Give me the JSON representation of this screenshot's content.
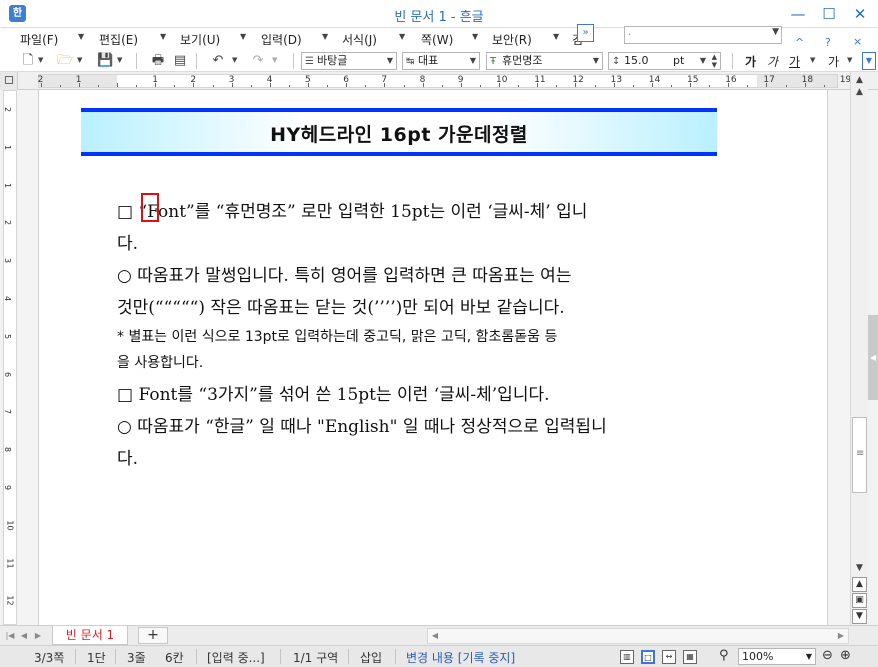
{
  "window": {
    "title": "빈 문서 1 - 흔글",
    "app_icon": "한",
    "controls": [
      "minimize-icon",
      "maximize-icon",
      "close-icon"
    ]
  },
  "menu": {
    "items": [
      "파일(F)",
      "편집(E)",
      "보기(U)",
      "입력(D)",
      "서식(J)",
      "쪽(W)",
      "보안(R)",
      "검"
    ],
    "more": "»",
    "search_value": ".",
    "right_controls": [
      "^",
      "?",
      "×"
    ]
  },
  "toolbar": {
    "style_combo": "바탕글",
    "font_type_combo": "대표",
    "font_combo": "휴먼명조",
    "size_value": "15.0",
    "size_unit": "pt",
    "format_buttons": [
      "가",
      "가",
      "가",
      "가"
    ]
  },
  "ruler": {
    "h_numbers": [
      "2",
      "1",
      "1",
      "2",
      "3",
      "4",
      "5",
      "6",
      "7",
      "8",
      "9",
      "10",
      "11",
      "12",
      "13",
      "14",
      "15",
      "16",
      "17",
      "18",
      "19"
    ],
    "v_numbers": [
      "2",
      "1",
      "1",
      "2",
      "3",
      "4",
      "5",
      "6",
      "7",
      "8",
      "9",
      "10",
      "11",
      "12",
      "13"
    ]
  },
  "document": {
    "heading": "HY헤드라인 16pt 가운데정렬",
    "paragraphs": [
      "□ “Font”를  “휴먼명조” 로만  입력한  15pt는  이런  ‘글씨-체’ 입니",
      "다.",
      "  ○  따옴표가  말썽입니다.  특히  영어를  입력하면  큰  따옴표는  여는",
      "것만(“““““)  작은  따옴표는  닫는  것(’’’’)만  되어  바보  같습니다.",
      "  * 별표는  이런  식으로  13pt로  입력하는데  중고딕,  맑은  고딕,  함초롬돋움  등",
      "을  사용합니다.",
      "□ Font를 “3가지”를  섞어  쓴  15pt는  이런 ‘글씨-체’입니다.",
      "  ○  따옴표가 “한글”  일  때나  \"English\"  일  때나  정상적으로  입력됩니",
      "다."
    ]
  },
  "tabs": {
    "doc_tab": "빈 문서 1",
    "add_tab": "+"
  },
  "status": {
    "page": "3/3쪽",
    "column": "1단",
    "line": "3줄",
    "col_pos": "6칸",
    "input_state": "[입력 중...]",
    "section": "1/1 구역",
    "insert_mode": "삽입",
    "track_changes": "변경 내용 [기록 중지]",
    "zoom": "100%"
  }
}
